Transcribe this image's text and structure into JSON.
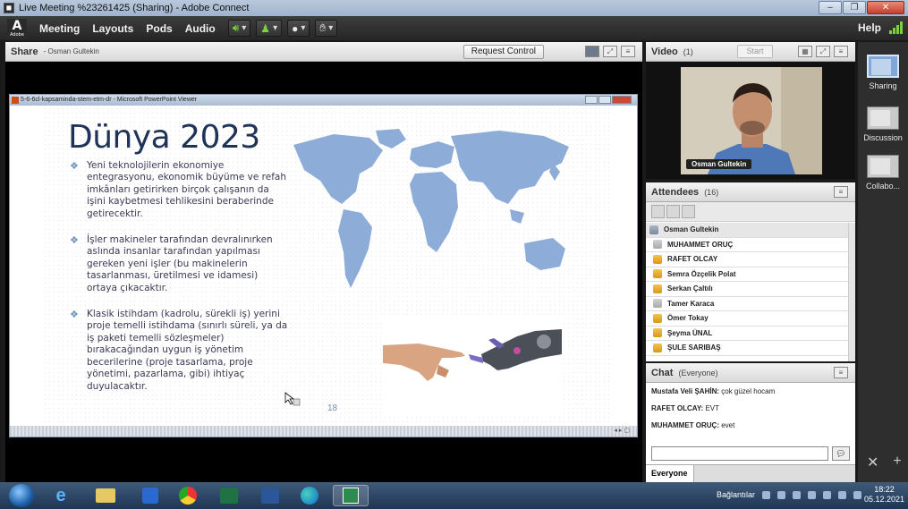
{
  "window": {
    "title": "Live Meeting %23261425 (Sharing) - Adobe Connect",
    "app_icon": "adobe-connect-icon",
    "controls": [
      "–",
      "❐",
      "✕"
    ]
  },
  "menubar": {
    "logo_text": "Adobe",
    "items": [
      "Meeting",
      "Layouts",
      "Pods",
      "Audio"
    ],
    "help": "Help",
    "tool_icons": [
      "speaker-icon",
      "camera-icon",
      "person-icon",
      "raise-hand-icon"
    ]
  },
  "share_pod": {
    "title": "Share",
    "presenter": "- Osman Gultekin",
    "request_control": "Request Control",
    "ppt_window_title": "5-6-6cl-kapsaminda-stem-etm-dr - Microsoft PowerPoint Viewer"
  },
  "slide": {
    "title": "Dünya 2023",
    "bullets": [
      "Yeni teknolojilerin ekonomiye entegrasyonu, ekonomik büyüme ve refah imkânları getirirken birçok çalışanın da işini kaybetmesi tehlikesini beraberinde getirecektir.",
      "İşler makineler tarafından devralınırken aslında insanlar tarafından yapılması gereken yeni işler (bu makinelerin tasarlanması, üretilmesi ve idamesi) ortaya çıkacaktır.",
      "Klasik istihdam (kadrolu, sürekli iş) yerini proje temelli istihdama (sınırlı süreli, ya da iş paketi temelli sözleşmeler) bırakacağından uygun iş yönetim becerilerine (proje tasarlama, proje yönetimi, pazarlama, gibi) ihtiyaç duyulacaktır."
    ],
    "page_number": "18",
    "bullet_color": "#6d8fb8",
    "title_color": "#1f3358",
    "map_color": "#8eacd8"
  },
  "video_pod": {
    "title": "Video",
    "count": "(1)",
    "start_label": "Start",
    "participant": "Osman Gultekin"
  },
  "attendees_pod": {
    "title": "Attendees",
    "count": "(16)",
    "host": "Osman Gultekin",
    "list": [
      {
        "name": "MUHAMMET ORUÇ",
        "role": "host"
      },
      {
        "name": "RAFET OLCAY",
        "role": "person"
      },
      {
        "name": "Semra Özçelik Polat",
        "role": "person"
      },
      {
        "name": "Serkan Çaltılı",
        "role": "person"
      },
      {
        "name": "Tamer Karaca",
        "role": "host"
      },
      {
        "name": "Ömer Tokay",
        "role": "person"
      },
      {
        "name": "Şeyma ÜNAL",
        "role": "person"
      },
      {
        "name": "ŞULE SARIBAŞ",
        "role": "person"
      }
    ]
  },
  "chat_pod": {
    "title": "Chat",
    "scope": "(Everyone)",
    "messages": [
      {
        "sender": "Mustafa Veli ŞAHİN:",
        "text": " çok güzel hocam"
      },
      {
        "sender": "RAFET OLCAY:",
        "text": " EVT"
      },
      {
        "sender": "MUHAMMET ORUÇ:",
        "text": " evet"
      }
    ],
    "tab": "Everyone",
    "send_icon": "speech-bubble-icon"
  },
  "layouts_rail": {
    "items": [
      "Sharing",
      "Discussion",
      "Collabo..."
    ],
    "active": "Sharing"
  },
  "taskbar": {
    "tray_label": "Bağlantılar",
    "time": "18:22",
    "date": "05.12.2021"
  }
}
